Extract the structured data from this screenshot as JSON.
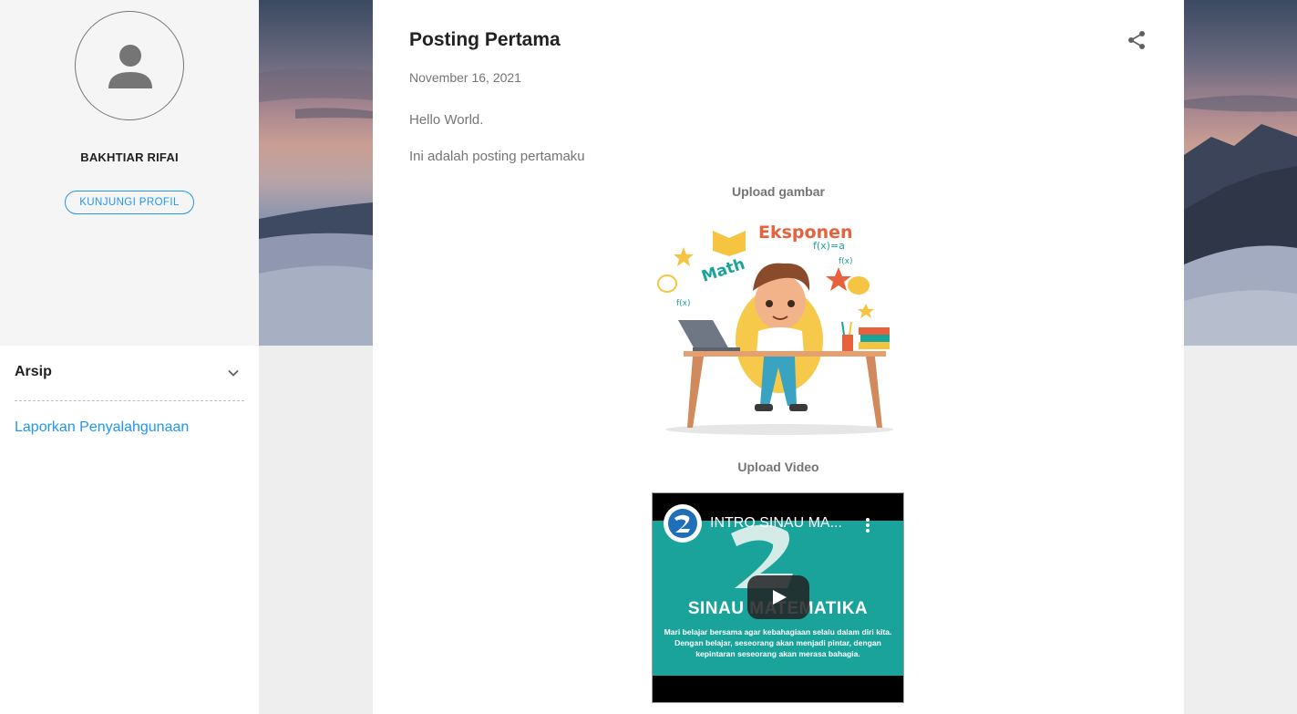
{
  "profile": {
    "name": "BAKHTIAR RIFAI",
    "visit_button": "KUNJUNGI PROFIL",
    "avatar_icon": "person-icon"
  },
  "sidebar": {
    "archive_title": "Arsip",
    "archive_icon": "chevron-down-icon",
    "report_link": "Laporkan Penyalahgunaan"
  },
  "post": {
    "title": "Posting Pertama",
    "date": "November 16, 2021",
    "paragraphs": [
      "Hello World.",
      "Ini adalah posting pertamaku"
    ],
    "image_caption": "Upload gambar",
    "video_caption": "Upload Video",
    "share_icon": "share-icon"
  },
  "illustration": {
    "words": [
      "Eksponen",
      "Math",
      "f(x)=a",
      "f(x)",
      "f(x)"
    ]
  },
  "video": {
    "title": "INTRO SINAU MA...",
    "big_title": "SINAU MATEMATIKA",
    "description": "Mari belajar bersama agar kebahagiaan selalu dalam diri kita. Dengan belajar, seseorang akan menjadi pintar, dengan kepintaran seseorang akan merasa bahagia.",
    "menu_icon": "more-vert-icon",
    "play_icon": "play-icon"
  },
  "colors": {
    "accent": "#2196f3",
    "video_teal": "#1aa39a",
    "text_primary": "#212121",
    "text_secondary": "#757575"
  }
}
